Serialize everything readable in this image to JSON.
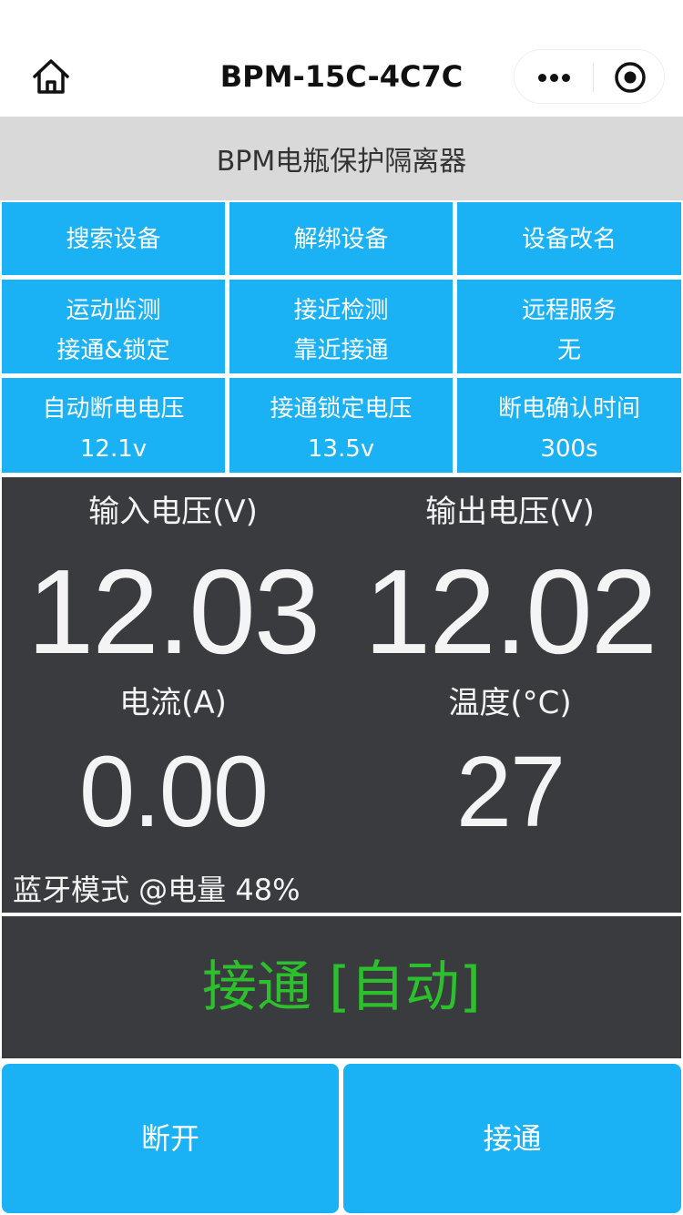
{
  "navbar": {
    "title": "BPM-15C-4C7C",
    "home_icon": "home-icon",
    "more_icon": "more-dots-icon",
    "close_icon": "target-close-icon"
  },
  "header": {
    "title": "BPM电瓶保护隔离器"
  },
  "buttons": {
    "search": "搜索设备",
    "unbind": "解绑设备",
    "rename": "设备改名",
    "motion": {
      "label": "运动监测",
      "value": "接通&锁定"
    },
    "proximity": {
      "label": "接近检测",
      "value": "靠近接通"
    },
    "remote": {
      "label": "远程服务",
      "value": "无"
    },
    "auto_cutoff": {
      "label": "自动断电电压",
      "value": "12.1v"
    },
    "connect_lock": {
      "label": "接通锁定电压",
      "value": "13.5v"
    },
    "confirm_time": {
      "label": "断电确认时间",
      "value": "300s"
    }
  },
  "monitor": {
    "input_voltage": {
      "label": "输入电压(V)",
      "value": "12.03"
    },
    "output_voltage": {
      "label": "输出电压(V)",
      "value": "12.02"
    },
    "current": {
      "label": "电流(A)",
      "value": "0.00"
    },
    "temperature": {
      "label": "温度(°C)",
      "value": "27"
    },
    "bluetooth_status": "蓝牙模式 @电量 48%"
  },
  "state": {
    "text": "接通 [自动]",
    "color": "#2cc02c"
  },
  "actions": {
    "disconnect": "断开",
    "connect": "接通"
  },
  "colors": {
    "accent": "#1ab2f4",
    "panel": "#3a3b3f",
    "header_bg": "#d9d9d9"
  }
}
